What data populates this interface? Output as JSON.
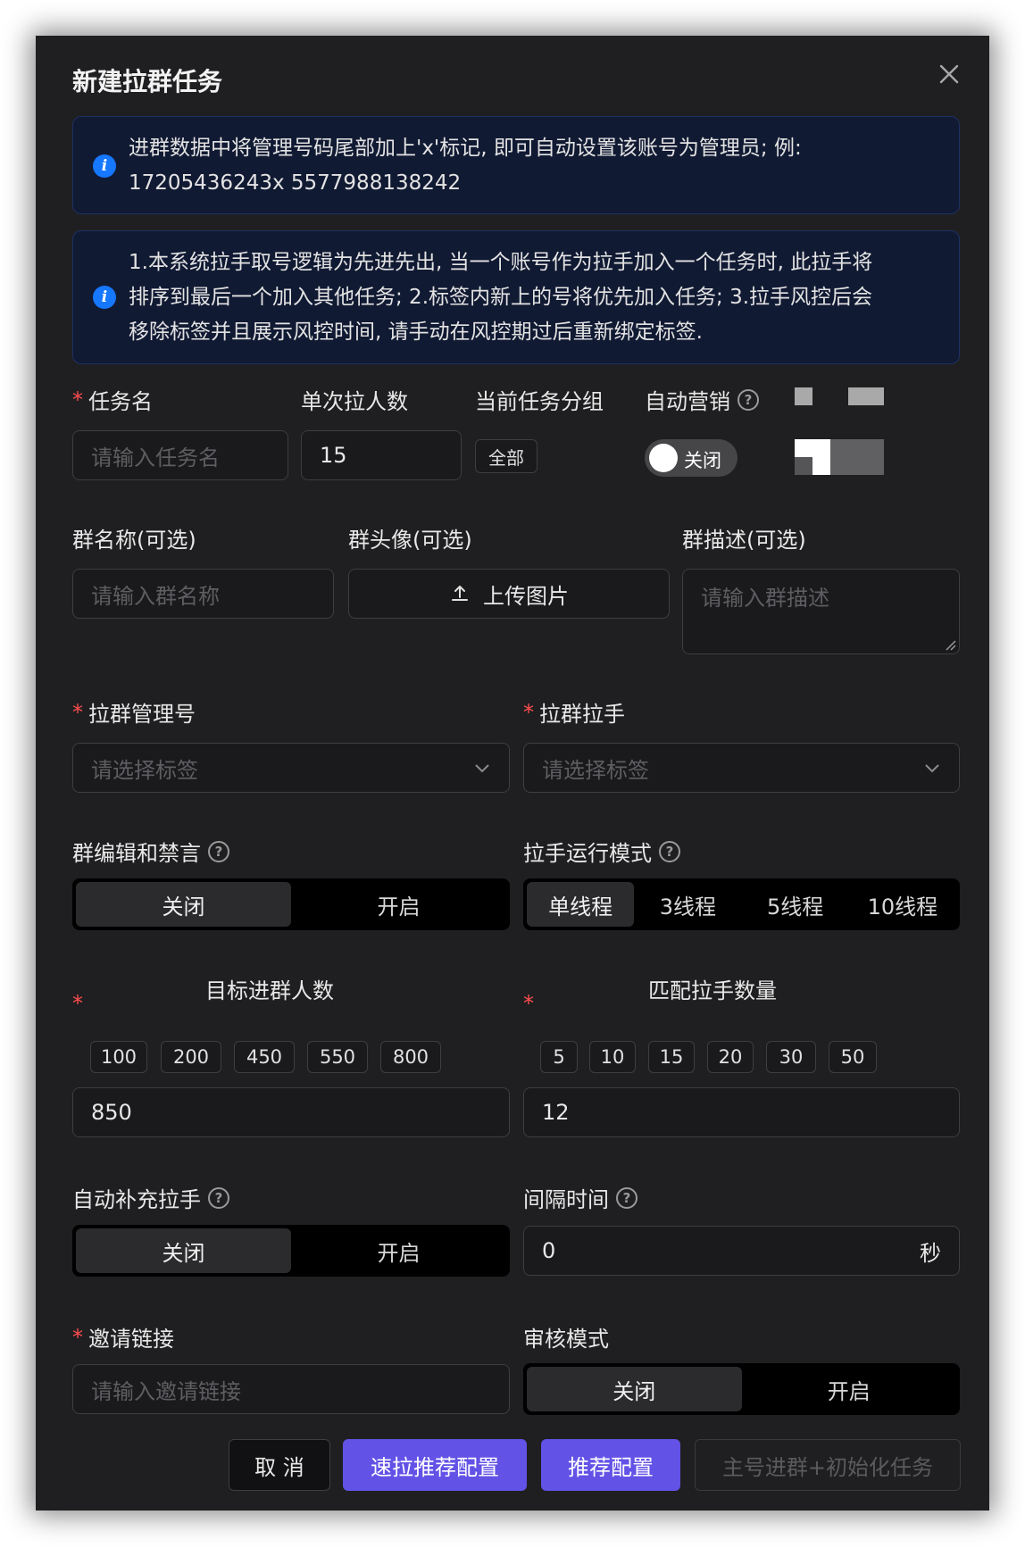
{
  "modal": {
    "title": "新建拉群任务"
  },
  "alerts": [
    {
      "lines": [
        "进群数据中将管理号码尾部加上'x'标记, 即可自动设置该账号为管理员; 例:",
        "17205436243x 5577988138242"
      ]
    },
    {
      "lines": [
        "1.本系统拉手取号逻辑为先进先出, 当一个账号作为拉手加入一个任务时, 此拉手将",
        "排序到最后一个加入其他任务; 2.标签内新上的号将优先加入任务; 3.拉手风控后会",
        "移除标签并且展示风控时间, 请手动在风控期过后重新绑定标签."
      ]
    }
  ],
  "row1": {
    "task_name": {
      "label": "任务名",
      "placeholder": "请输入任务名"
    },
    "per_pull": {
      "label": "单次拉人数",
      "value": "15"
    },
    "group": {
      "label": "当前任务分组",
      "tag": "全部"
    },
    "auto_marketing": {
      "label": "自动营销",
      "toggle_text": "关闭"
    }
  },
  "row2": {
    "group_name": {
      "label": "群名称(可选)",
      "placeholder": "请输入群名称"
    },
    "group_avatar": {
      "label": "群头像(可选)",
      "button": "上传图片"
    },
    "group_desc": {
      "label": "群描述(可选)",
      "placeholder": "请输入群描述"
    }
  },
  "row3": {
    "admin": {
      "label": "拉群管理号",
      "placeholder": "请选择标签"
    },
    "puller": {
      "label": "拉群拉手",
      "placeholder": "请选择标签"
    }
  },
  "row4": {
    "edit_ban": {
      "label": "群编辑和禁言",
      "options": [
        "关闭",
        "开启"
      ]
    },
    "run_mode": {
      "label": "拉手运行模式",
      "options": [
        "单线程",
        "3线程",
        "5线程",
        "10线程"
      ]
    }
  },
  "row5": {
    "target": {
      "label": "目标进群人数",
      "presets": [
        "100",
        "200",
        "450",
        "550",
        "800"
      ],
      "value": "850"
    },
    "match": {
      "label": "匹配拉手数量",
      "presets": [
        "5",
        "10",
        "15",
        "20",
        "30",
        "50"
      ],
      "value": "12"
    }
  },
  "row6": {
    "auto_fill": {
      "label": "自动补充拉手",
      "options": [
        "关闭",
        "开启"
      ]
    },
    "interval": {
      "label": "间隔时间",
      "value": "0",
      "unit": "秒"
    }
  },
  "row7": {
    "invite": {
      "label": "邀请链接",
      "placeholder": "请输入邀请链接"
    },
    "review": {
      "label": "审核模式",
      "options": [
        "关闭",
        "开启"
      ]
    }
  },
  "footer": {
    "cancel": "取 消",
    "fast_config": "速拉推荐配置",
    "recommend": "推荐配置",
    "main_join": "主号进群+初始化任务"
  },
  "colors": {
    "primary": "#6252e6",
    "info": "#1677ff",
    "required": "#ff4d4f"
  }
}
